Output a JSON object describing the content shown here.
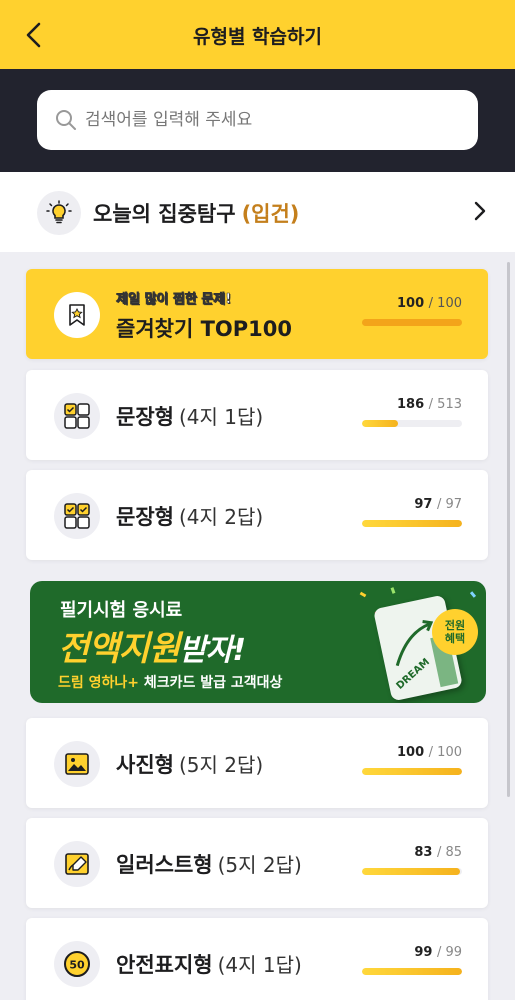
{
  "header": {
    "title": "유형별 학습하기"
  },
  "search": {
    "placeholder": "검색어를 입력해 주세요"
  },
  "focus": {
    "label": "오늘의 집중탐구",
    "badge": "(입건)"
  },
  "featured": {
    "kicker": "제일 많이 찜한 문제!",
    "title": "즐겨찾기 TOP100",
    "done": "100",
    "total": "/ 100",
    "progress": 1.0
  },
  "items": [
    {
      "title": "문장형",
      "sub": "(4지 1답)",
      "done": "186",
      "total": "/ 513",
      "progress": 0.363,
      "icon": "grid-check-one-icon"
    },
    {
      "title": "문장형",
      "sub": "(4지 2답)",
      "done": "97",
      "total": "/ 97",
      "progress": 1.0,
      "icon": "grid-check-two-icon"
    },
    {
      "title": "사진형",
      "sub": "(5지 2답)",
      "done": "100",
      "total": "/ 100",
      "progress": 1.0,
      "icon": "photo-icon"
    },
    {
      "title": "일러스트형",
      "sub": "(5지 2답)",
      "done": "83",
      "total": "/ 85",
      "progress": 0.976,
      "icon": "illustration-icon"
    },
    {
      "title": "안전표지형",
      "sub": "(4지 1답)",
      "done": "99",
      "total": "/ 99",
      "progress": 1.0,
      "icon": "speed-sign-icon",
      "sign_text": "50"
    }
  ],
  "banner": {
    "line1": "필기시험 응시료",
    "line2_highlight": "전액지원",
    "line2_rest": "받자!",
    "line3_highlight": "드림 영하나+",
    "line3_rest": " 체크카드 발급 고객대상",
    "badge_top": "전원",
    "badge_bottom": "혜택",
    "card_text": "DREAM"
  },
  "colors": {
    "brand_yellow": "#ffd12e",
    "dark_band": "#22232e",
    "banner_green": "#1f6a2a",
    "accent_orange": "#c47f1c"
  }
}
